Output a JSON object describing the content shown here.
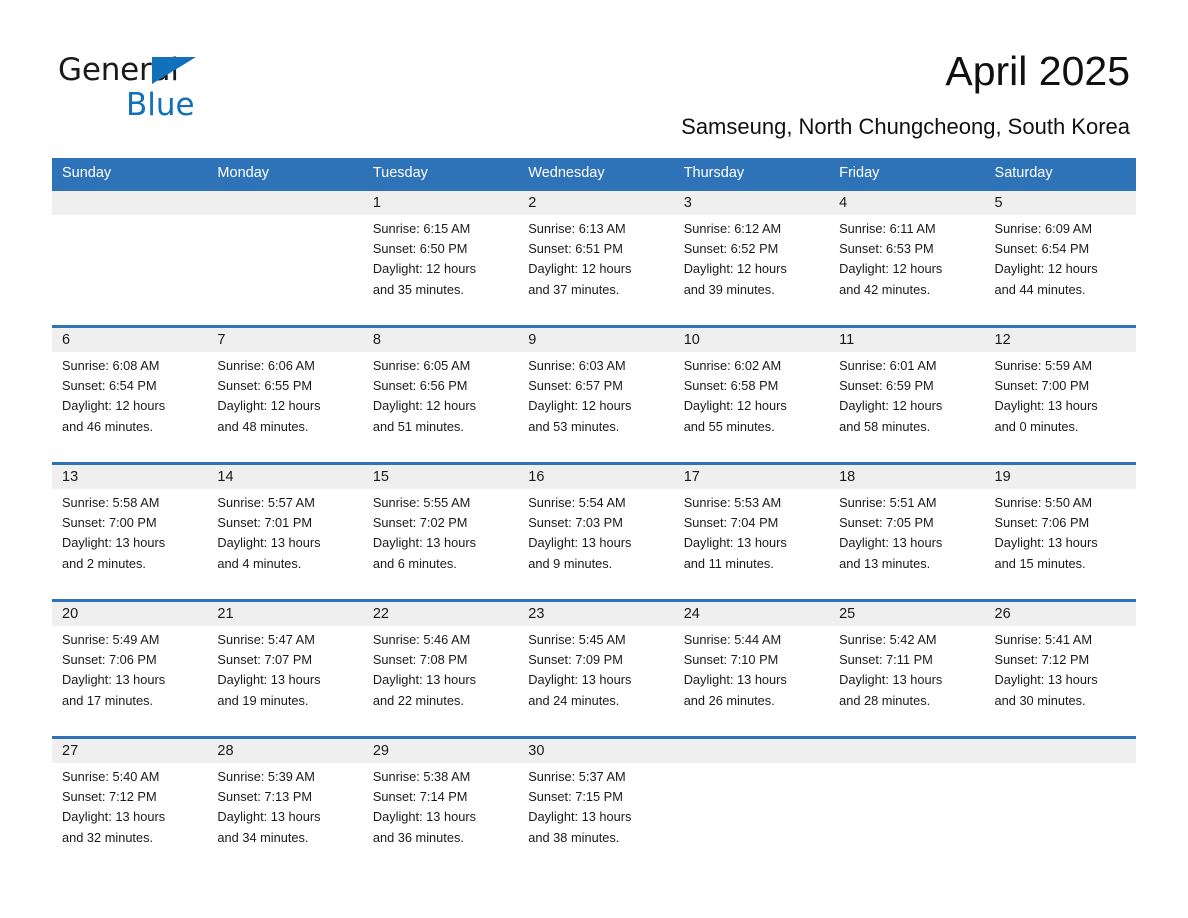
{
  "brand": {
    "name_part1": "General",
    "name_part2": "Blue",
    "triangle_icon": "triangle-icon",
    "accent_color": "#1271bb"
  },
  "header": {
    "title": "April 2025",
    "location": "Samseung, North Chungcheong, South Korea"
  },
  "theme": {
    "header_blue": "#2e73b8",
    "date_band_gray": "#efefef",
    "text": "#1a1a1a"
  },
  "calendar": {
    "weekday_headers": [
      "Sunday",
      "Monday",
      "Tuesday",
      "Wednesday",
      "Thursday",
      "Friday",
      "Saturday"
    ],
    "labels": {
      "sunrise_prefix": "Sunrise: ",
      "sunset_prefix": "Sunset: ",
      "daylight_prefix": "Daylight: "
    },
    "weeks": [
      {
        "days": [
          {
            "date": "",
            "sunrise": "",
            "sunset": "",
            "daylight_line1": "",
            "daylight_line2": ""
          },
          {
            "date": "",
            "sunrise": "",
            "sunset": "",
            "daylight_line1": "",
            "daylight_line2": ""
          },
          {
            "date": "1",
            "sunrise": "Sunrise: 6:15 AM",
            "sunset": "Sunset: 6:50 PM",
            "daylight_line1": "Daylight: 12 hours",
            "daylight_line2": "and 35 minutes."
          },
          {
            "date": "2",
            "sunrise": "Sunrise: 6:13 AM",
            "sunset": "Sunset: 6:51 PM",
            "daylight_line1": "Daylight: 12 hours",
            "daylight_line2": "and 37 minutes."
          },
          {
            "date": "3",
            "sunrise": "Sunrise: 6:12 AM",
            "sunset": "Sunset: 6:52 PM",
            "daylight_line1": "Daylight: 12 hours",
            "daylight_line2": "and 39 minutes."
          },
          {
            "date": "4",
            "sunrise": "Sunrise: 6:11 AM",
            "sunset": "Sunset: 6:53 PM",
            "daylight_line1": "Daylight: 12 hours",
            "daylight_line2": "and 42 minutes."
          },
          {
            "date": "5",
            "sunrise": "Sunrise: 6:09 AM",
            "sunset": "Sunset: 6:54 PM",
            "daylight_line1": "Daylight: 12 hours",
            "daylight_line2": "and 44 minutes."
          }
        ]
      },
      {
        "days": [
          {
            "date": "6",
            "sunrise": "Sunrise: 6:08 AM",
            "sunset": "Sunset: 6:54 PM",
            "daylight_line1": "Daylight: 12 hours",
            "daylight_line2": "and 46 minutes."
          },
          {
            "date": "7",
            "sunrise": "Sunrise: 6:06 AM",
            "sunset": "Sunset: 6:55 PM",
            "daylight_line1": "Daylight: 12 hours",
            "daylight_line2": "and 48 minutes."
          },
          {
            "date": "8",
            "sunrise": "Sunrise: 6:05 AM",
            "sunset": "Sunset: 6:56 PM",
            "daylight_line1": "Daylight: 12 hours",
            "daylight_line2": "and 51 minutes."
          },
          {
            "date": "9",
            "sunrise": "Sunrise: 6:03 AM",
            "sunset": "Sunset: 6:57 PM",
            "daylight_line1": "Daylight: 12 hours",
            "daylight_line2": "and 53 minutes."
          },
          {
            "date": "10",
            "sunrise": "Sunrise: 6:02 AM",
            "sunset": "Sunset: 6:58 PM",
            "daylight_line1": "Daylight: 12 hours",
            "daylight_line2": "and 55 minutes."
          },
          {
            "date": "11",
            "sunrise": "Sunrise: 6:01 AM",
            "sunset": "Sunset: 6:59 PM",
            "daylight_line1": "Daylight: 12 hours",
            "daylight_line2": "and 58 minutes."
          },
          {
            "date": "12",
            "sunrise": "Sunrise: 5:59 AM",
            "sunset": "Sunset: 7:00 PM",
            "daylight_line1": "Daylight: 13 hours",
            "daylight_line2": "and 0 minutes."
          }
        ]
      },
      {
        "days": [
          {
            "date": "13",
            "sunrise": "Sunrise: 5:58 AM",
            "sunset": "Sunset: 7:00 PM",
            "daylight_line1": "Daylight: 13 hours",
            "daylight_line2": "and 2 minutes."
          },
          {
            "date": "14",
            "sunrise": "Sunrise: 5:57 AM",
            "sunset": "Sunset: 7:01 PM",
            "daylight_line1": "Daylight: 13 hours",
            "daylight_line2": "and 4 minutes."
          },
          {
            "date": "15",
            "sunrise": "Sunrise: 5:55 AM",
            "sunset": "Sunset: 7:02 PM",
            "daylight_line1": "Daylight: 13 hours",
            "daylight_line2": "and 6 minutes."
          },
          {
            "date": "16",
            "sunrise": "Sunrise: 5:54 AM",
            "sunset": "Sunset: 7:03 PM",
            "daylight_line1": "Daylight: 13 hours",
            "daylight_line2": "and 9 minutes."
          },
          {
            "date": "17",
            "sunrise": "Sunrise: 5:53 AM",
            "sunset": "Sunset: 7:04 PM",
            "daylight_line1": "Daylight: 13 hours",
            "daylight_line2": "and 11 minutes."
          },
          {
            "date": "18",
            "sunrise": "Sunrise: 5:51 AM",
            "sunset": "Sunset: 7:05 PM",
            "daylight_line1": "Daylight: 13 hours",
            "daylight_line2": "and 13 minutes."
          },
          {
            "date": "19",
            "sunrise": "Sunrise: 5:50 AM",
            "sunset": "Sunset: 7:06 PM",
            "daylight_line1": "Daylight: 13 hours",
            "daylight_line2": "and 15 minutes."
          }
        ]
      },
      {
        "days": [
          {
            "date": "20",
            "sunrise": "Sunrise: 5:49 AM",
            "sunset": "Sunset: 7:06 PM",
            "daylight_line1": "Daylight: 13 hours",
            "daylight_line2": "and 17 minutes."
          },
          {
            "date": "21",
            "sunrise": "Sunrise: 5:47 AM",
            "sunset": "Sunset: 7:07 PM",
            "daylight_line1": "Daylight: 13 hours",
            "daylight_line2": "and 19 minutes."
          },
          {
            "date": "22",
            "sunrise": "Sunrise: 5:46 AM",
            "sunset": "Sunset: 7:08 PM",
            "daylight_line1": "Daylight: 13 hours",
            "daylight_line2": "and 22 minutes."
          },
          {
            "date": "23",
            "sunrise": "Sunrise: 5:45 AM",
            "sunset": "Sunset: 7:09 PM",
            "daylight_line1": "Daylight: 13 hours",
            "daylight_line2": "and 24 minutes."
          },
          {
            "date": "24",
            "sunrise": "Sunrise: 5:44 AM",
            "sunset": "Sunset: 7:10 PM",
            "daylight_line1": "Daylight: 13 hours",
            "daylight_line2": "and 26 minutes."
          },
          {
            "date": "25",
            "sunrise": "Sunrise: 5:42 AM",
            "sunset": "Sunset: 7:11 PM",
            "daylight_line1": "Daylight: 13 hours",
            "daylight_line2": "and 28 minutes."
          },
          {
            "date": "26",
            "sunrise": "Sunrise: 5:41 AM",
            "sunset": "Sunset: 7:12 PM",
            "daylight_line1": "Daylight: 13 hours",
            "daylight_line2": "and 30 minutes."
          }
        ]
      },
      {
        "days": [
          {
            "date": "27",
            "sunrise": "Sunrise: 5:40 AM",
            "sunset": "Sunset: 7:12 PM",
            "daylight_line1": "Daylight: 13 hours",
            "daylight_line2": "and 32 minutes."
          },
          {
            "date": "28",
            "sunrise": "Sunrise: 5:39 AM",
            "sunset": "Sunset: 7:13 PM",
            "daylight_line1": "Daylight: 13 hours",
            "daylight_line2": "and 34 minutes."
          },
          {
            "date": "29",
            "sunrise": "Sunrise: 5:38 AM",
            "sunset": "Sunset: 7:14 PM",
            "daylight_line1": "Daylight: 13 hours",
            "daylight_line2": "and 36 minutes."
          },
          {
            "date": "30",
            "sunrise": "Sunrise: 5:37 AM",
            "sunset": "Sunset: 7:15 PM",
            "daylight_line1": "Daylight: 13 hours",
            "daylight_line2": "and 38 minutes."
          },
          {
            "date": "",
            "sunrise": "",
            "sunset": "",
            "daylight_line1": "",
            "daylight_line2": ""
          },
          {
            "date": "",
            "sunrise": "",
            "sunset": "",
            "daylight_line1": "",
            "daylight_line2": ""
          },
          {
            "date": "",
            "sunrise": "",
            "sunset": "",
            "daylight_line1": "",
            "daylight_line2": ""
          }
        ]
      }
    ]
  }
}
